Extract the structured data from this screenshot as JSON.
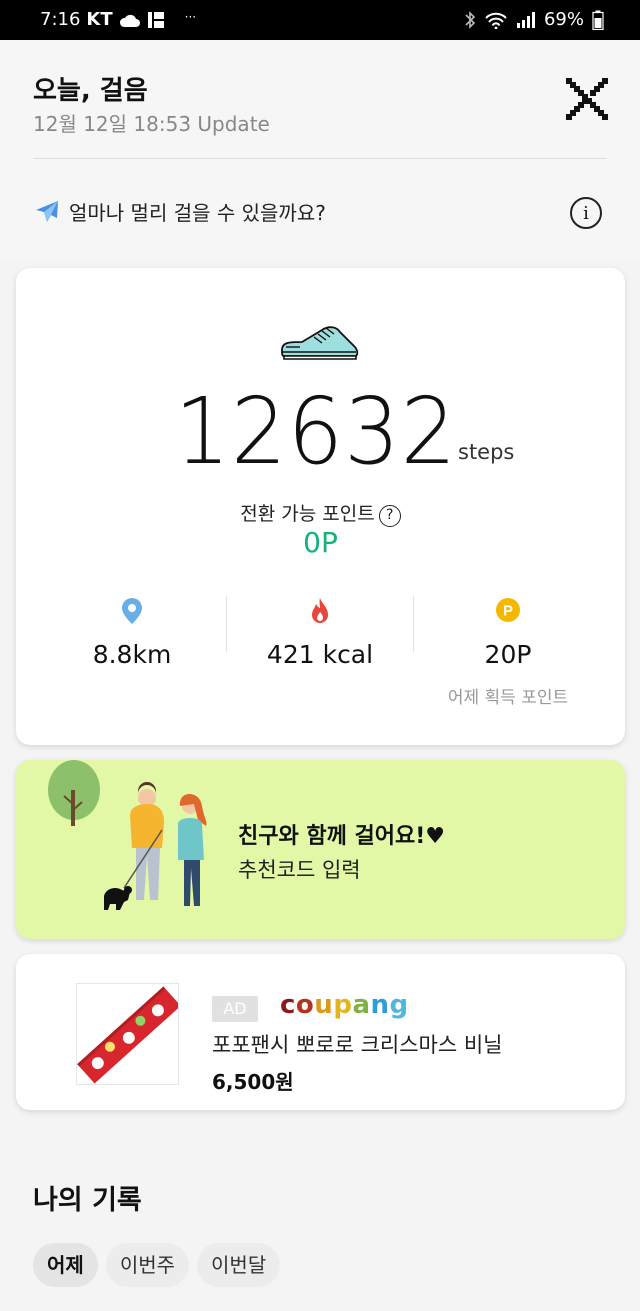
{
  "status_bar": {
    "time": "7:16",
    "carrier": "KT",
    "dots": "···",
    "battery": "69%"
  },
  "header": {
    "title": "오늘, 걸음",
    "updated": "12월 12일 18:53 Update"
  },
  "question": {
    "text": "얼마나 멀리 걸을 수 있을까요?"
  },
  "steps_card": {
    "steps": "12632",
    "steps_unit": "steps",
    "points_label": "전환 가능 포인트",
    "points_help": "?",
    "points_value": "0P",
    "distance": "8.8km",
    "calories": "421 kcal",
    "yesterday_points": "20P",
    "yesterday_points_label": "어제 획득 포인트",
    "points_badge": "P"
  },
  "friend_banner": {
    "title": "친구와 함께 걸어요!♥",
    "subtitle": "추천코드 입력"
  },
  "ad": {
    "badge": "AD",
    "brand_letters": [
      "c",
      "o",
      "u",
      "p",
      "a",
      "n",
      "g"
    ],
    "brand_colors": [
      "#8b1a1a",
      "#b4341b",
      "#d99b1a",
      "#e0b51f",
      "#7cb342",
      "#2f9dd8",
      "#4fb6e0"
    ],
    "product_name": "포포팬시 뽀로로 크리스마스 비닐",
    "price": "6,500원"
  },
  "records": {
    "title": "나의 기록",
    "tabs": [
      "어제",
      "이번주",
      "이번달"
    ]
  },
  "colors": {
    "points_green": "#16b27a",
    "banner_bg": "#e3f8a6",
    "location_blue": "#6aaee6",
    "fire_red": "#e8453c",
    "coin_yellow": "#f5b800"
  }
}
